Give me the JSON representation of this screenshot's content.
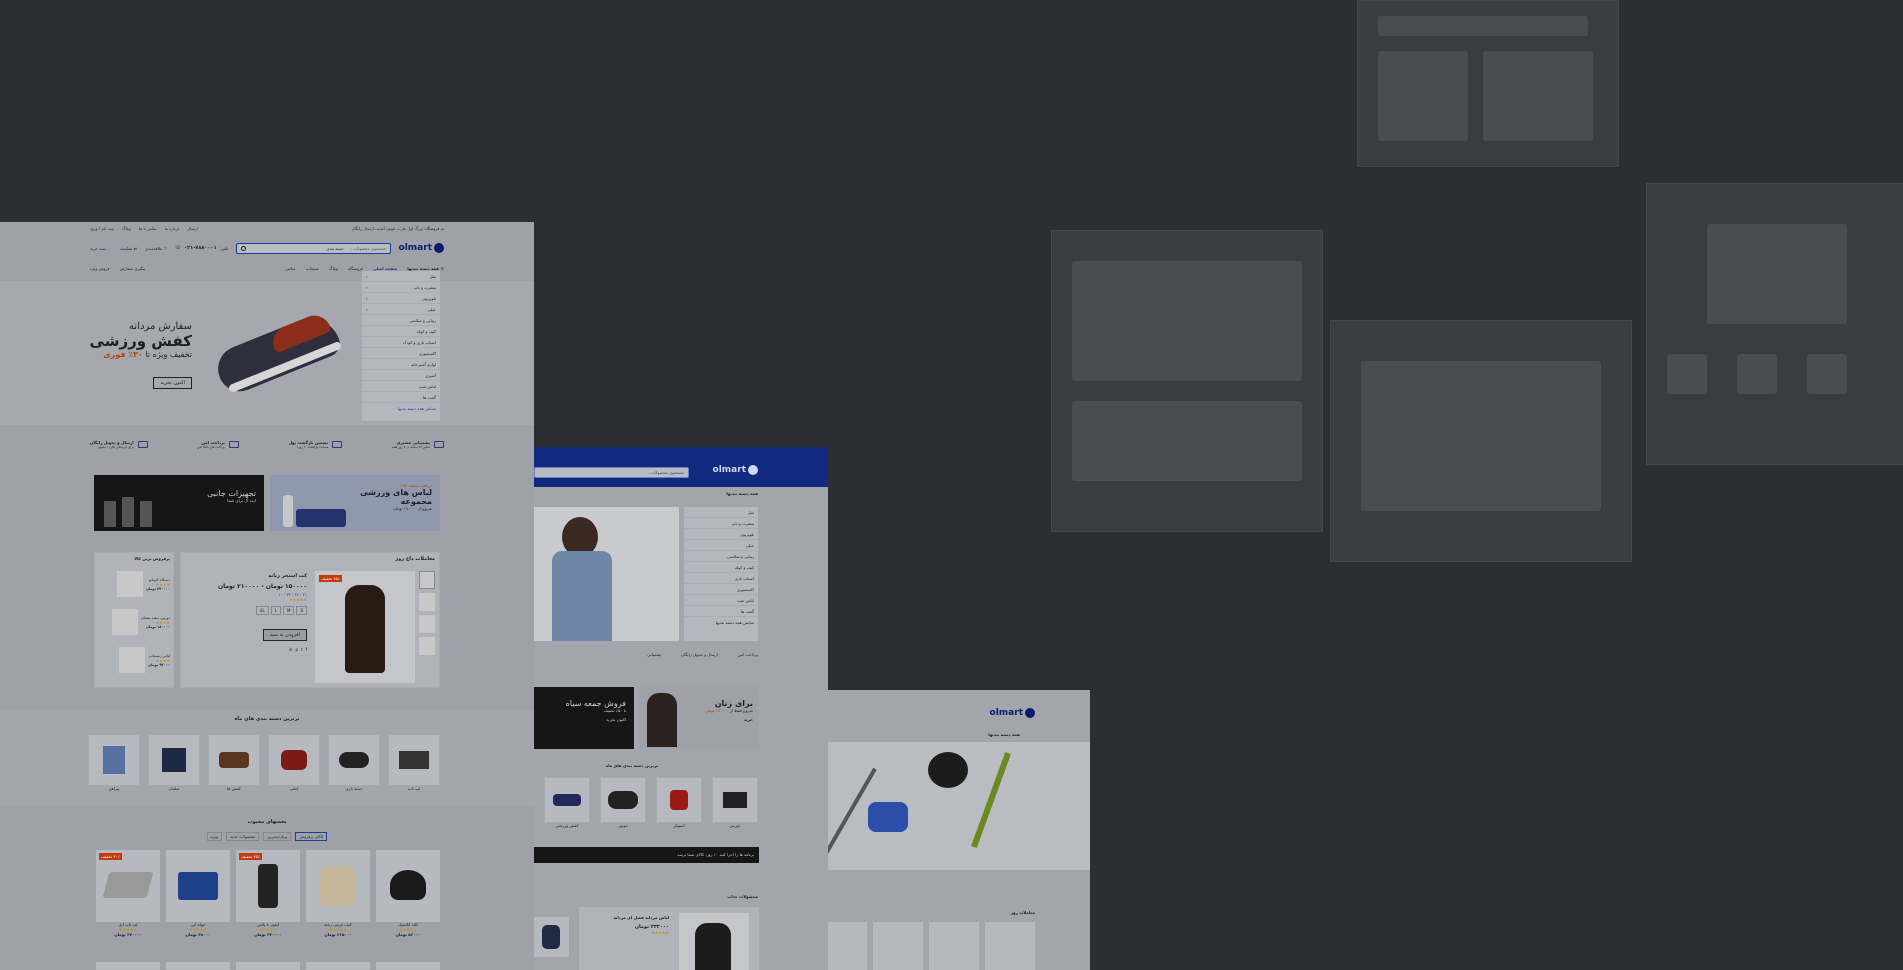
{
  "win1": {
    "topbar": {
      "promo": "به فروشگاه بزرگ اول مارت خوش آمدید، ارسال رایگان",
      "links": [
        "ثبت نام / ورود",
        "ویلاگ",
        "تماس با ما",
        "درباره ما",
        "ارسال"
      ]
    },
    "header": {
      "logo": "olmart",
      "search_placeholder": "جستجوی محصولات...",
      "search_category": "دسته بندی",
      "phone_label": "تلفن:",
      "phone": "۰۲۱-۷۸۸۰۰۰۱",
      "wishlist": "علاقه‌مندی",
      "compare": "مقایسه",
      "cart": "سبد خرید"
    },
    "nav": {
      "all_categories": "همه دسته بندیها",
      "items": [
        "صفحه اصلی",
        "فروشگاه",
        "وبلاگ",
        "صفحات",
        "عناصر"
      ],
      "right_items": [
        "پیگیری سفارش",
        "فروش ویژه"
      ]
    },
    "categories": [
      "مبل",
      "تیشرت و تاپ",
      "تلویزیون",
      "جیلی",
      "زیبایی و سلامتی",
      "کیف و کوله",
      "اسباب بازی و کودک",
      "اکسسوری",
      "لوازم آشپزخانه",
      "آشپزی",
      "لباس شب",
      "گجت ها"
    ],
    "categories_more": "نمایش همه دسته بندیها",
    "hero": {
      "line1": "سفارش مردانه",
      "line2": "کفش ورزشی",
      "line3_prefix": "تخفیف ویژه تا",
      "line3_accent": "۳۰٪ فوری",
      "cta": "اکنون بخرید"
    },
    "features": [
      {
        "title": "پشتیبانی مشتری",
        "sub": "تماس ۲۴ ساعته در ۷ روز هفته"
      },
      {
        "title": "تضمین بازگشت پول",
        "sub": "ضمانت بازگشت ۳۰ روزه"
      },
      {
        "title": "پرداخت امن",
        "sub": "پرداخت های کاملا امن"
      },
      {
        "title": "ارسال و تحویل رایگان",
        "sub": "برای خریدهای بالای ۱ میلیون"
      }
    ],
    "banner_left": {
      "accent": "دریافت تخفیف ۲۵٪",
      "title1": "لباس های ورزشی",
      "title2": "مجموعه",
      "sub": "شروع از ۱۹۰۰۰۰ تومان"
    },
    "banner_right": {
      "title": "تجهیزات جانبی",
      "sub": "ایده آل برای شما"
    },
    "deals_title": "معاملات داغ روز",
    "deal": {
      "badge": "۲۵٪ تخفیف",
      "name": "کت استخر زنانه",
      "price": "۱۵۰۰۰۰ تومان - ۲۱۰۰۰۰ تومان",
      "timer": "۲۱ : ۴۲ : ۲۳ : ۱۰",
      "button": "افزودن به سبد"
    },
    "bestsellers_title": "پرفروش ترین کالا",
    "bestsellers": [
      {
        "name": "دستگاه کاپیتانو",
        "price": "۲۴۰۰۰۰ تومان"
      },
      {
        "name": "دوربین سفید مشکی",
        "price": "۱۸۰۰۰۰ تومان"
      },
      {
        "name": "لباس زمستانی",
        "price": "۹۲۰۰۰ تومان"
      }
    ],
    "topcats_title": "برترین دسته بندی های ماه",
    "topcats": [
      "لپ تاپ",
      "دسته بازی",
      "کتانی",
      "کفش ها",
      "مبلمان",
      "پیراهن"
    ],
    "popular_title": "بخشهای محبوب",
    "popular_tabs": [
      "کالای پرفروش",
      "پربازدیدترین",
      "محصولات جدید",
      "ویژه"
    ],
    "products": [
      {
        "name": "کلاه کلاسیک",
        "price": "۵۶۰۰۰ تومان",
        "badge": ""
      },
      {
        "name": "کیف چرمی زنانه",
        "price": "۲۶۵۰۰۰ تومان",
        "badge": ""
      },
      {
        "name": "آیفون ۸ پلاس",
        "price": "۳۴۰۰۰۰ تومان",
        "badge": "۲۵٪ تخفیف"
      },
      {
        "name": "حوله آبی",
        "price": "۴۸۰۰۰ تومان",
        "badge": ""
      },
      {
        "name": "لپ تاپ اپل",
        "price": "۴۷۰۰۰۰ تومان",
        "badge": "۳۰٪ تخفیف"
      }
    ]
  },
  "win2": {
    "logo": "olmart",
    "search_placeholder": "جستجوی محصولات...",
    "all_categories": "همه دسته بندیها",
    "categories": [
      "مبل",
      "تیشرت و تاپ",
      "تلویزیون",
      "جیلی",
      "زیبایی و سلامتی",
      "کیف و کوله",
      "اسباب بازی",
      "اکسسوری",
      "لباس شب",
      "گجت ها",
      "نمایش همه دسته بندیها"
    ],
    "features": [
      "پرداخت امن",
      "ارسال و تحویل رایگان",
      "پشتیبانی"
    ],
    "banner_women": {
      "title": "برای زنان",
      "sub": "شروع فقط از",
      "price": "۱۹۰۰۰۰ تومان",
      "cta": "خرید"
    },
    "banner_sale": {
      "title": "فروش جمعه سیاه",
      "sub": "تا ۵۰٪ تخفیف",
      "cta": "اکنون بخرید"
    },
    "topcats_title": "برترین دسته بندی های ماه",
    "topcats": [
      "دوربین",
      "اسپیکر",
      "موتور",
      "کفش ورزشی"
    ],
    "notice": "برنامه ها را اجرا کنید ۱۰ روز، کالای شما برسد",
    "popular_title": "محصولات جذاب",
    "deal_name": "لباس مردانه فصل ای مردانه",
    "deal_price": "۲۳۲۰۰۰ تومان"
  },
  "win3": {
    "logo": "olmart",
    "all_categories": "همه دسته بندیها",
    "deals_title": "معاملات روز"
  }
}
